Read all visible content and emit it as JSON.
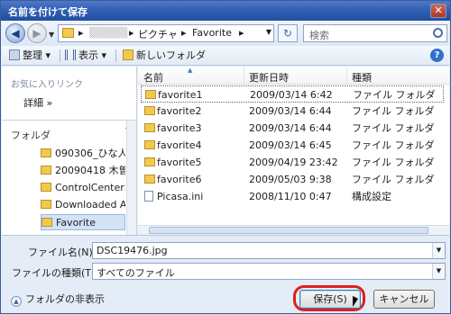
{
  "window": {
    "title": "名前を付けて保存",
    "close": "✕"
  },
  "address": {
    "back": "◀",
    "forward": "▶",
    "crumbs": [
      "▸",
      "ピクチャ",
      "▸",
      "Favorite",
      "▸"
    ],
    "refresh": "↻",
    "search_placeholder": "検索"
  },
  "toolbar": {
    "organize": "整理 ▾",
    "views": "表示 ▾",
    "new_folder": "新しいフォルダ",
    "help": "?"
  },
  "left": {
    "favorites_title": "お気に入りリンク",
    "more": "詳細 »",
    "folders_label": "フォルダ",
    "folders_chev": "⌃",
    "tree": [
      "090306_ひな人",
      "20090418 木曽",
      "ControlCenter3",
      "Downloaded Al",
      "Favorite"
    ]
  },
  "files": {
    "headers": {
      "name": "名前",
      "date": "更新日時",
      "type": "種類"
    },
    "rows": [
      {
        "name": "favorite1",
        "date": "2009/03/14 6:42",
        "type": "ファイル フォルダ"
      },
      {
        "name": "favorite2",
        "date": "2009/03/14 6:44",
        "type": "ファイル フォルダ"
      },
      {
        "name": "favorite3",
        "date": "2009/03/14 6:44",
        "type": "ファイル フォルダ"
      },
      {
        "name": "favorite4",
        "date": "2009/03/14 6:45",
        "type": "ファイル フォルダ"
      },
      {
        "name": "favorite5",
        "date": "2009/04/19 23:42",
        "type": "ファイル フォルダ"
      },
      {
        "name": "favorite6",
        "date": "2009/05/03 9:38",
        "type": "ファイル フォルダ"
      },
      {
        "name": "Picasa.ini",
        "date": "2008/11/10 0:47",
        "type": "構成設定"
      }
    ]
  },
  "form": {
    "filename_label": "ファイル名(N):",
    "filename_value": "DSC19476.jpg",
    "filetype_label": "ファイルの種類(T):",
    "filetype_value": "すべてのファイル",
    "hide_folders": "フォルダの非表示",
    "save": "保存(S)",
    "cancel": "キャンセル"
  },
  "colors": {
    "title_bar": "#2f5db3",
    "highlight_ring": "#e0201a",
    "selection": "#d3e2f6"
  }
}
